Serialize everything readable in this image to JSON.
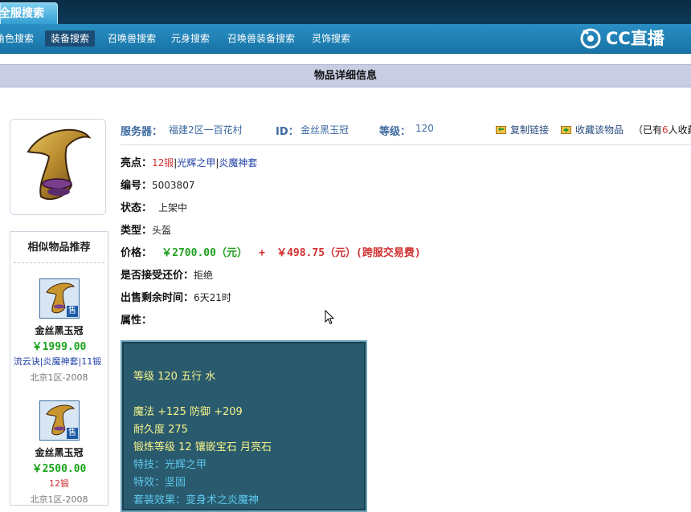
{
  "top_tab": {
    "label": "全服搜索"
  },
  "nav": {
    "items": [
      {
        "label": "角色搜索"
      },
      {
        "label": "装备搜索"
      },
      {
        "label": "召唤兽搜索"
      },
      {
        "label": "元身搜索"
      },
      {
        "label": "召唤兽装备搜索"
      },
      {
        "label": "灵饰搜索"
      }
    ],
    "active_index": 1
  },
  "logo": {
    "text": "CC直播",
    "icon": "cc-logo-icon"
  },
  "page_title": "物品详细信息",
  "info": {
    "server_label": "服务器：",
    "server_value": "福建2区一百花村",
    "id_label": "ID：",
    "id_value": "金丝黑玉冠",
    "level_label": "等级：",
    "level_value": "120",
    "copy_link": "复制链接",
    "favorite": "收藏该物品",
    "fav_prefix": "（已有",
    "fav_count": "6",
    "fav_suffix": "人收藏"
  },
  "details": {
    "highlight_label": "亮点：",
    "highlight_forge": "12锻",
    "highlight_sep1": "|",
    "highlight_skill": "光辉之甲",
    "highlight_sep2": "|",
    "highlight_set": "炎魔神套",
    "number_label": "编号：",
    "number_value": "5003807",
    "status_label": "状态：",
    "status_value": "上架中",
    "type_label": "类型：",
    "type_value": "头盔",
    "price_label": "价格：",
    "price_value": "￥2700.00（元）",
    "price_plus": "+",
    "price_fee": "￥498.75（元）(跨服交易费)",
    "counter_label": "是否接受还价：",
    "counter_value": "拒绝",
    "remaining_label": "出售剩余时间：",
    "remaining_value": "6天21时",
    "attr_label": "属性："
  },
  "attributes": {
    "line1": "等级 120 五行 水",
    "line2": "魔法 +125 防御 +209",
    "line3": "耐久度 275",
    "line4": "锻炼等级 12 镶嵌宝石 月亮石",
    "line5": "特技：光辉之甲",
    "line6": "特效：坚固",
    "line7": "套装效果：变身术之炎魔神"
  },
  "similar": {
    "title": "相似物品推荐",
    "items": [
      {
        "name": "金丝黑玉冠",
        "price": "￥1999.00",
        "tags": "流云诀|炎魔神套|11锻",
        "server": "北京1区-2008",
        "badge": "售"
      },
      {
        "name": "金丝黑玉冠",
        "price": "￥2500.00",
        "tags": "12锻",
        "server": "北京1区-2008",
        "badge": "售"
      }
    ]
  },
  "colors": {
    "nav_bg": "#1f82b8",
    "title_bar": "#c9cde3",
    "attr_panel": "#295a6d",
    "price_green": "#21a021",
    "price_red": "#d23131"
  }
}
